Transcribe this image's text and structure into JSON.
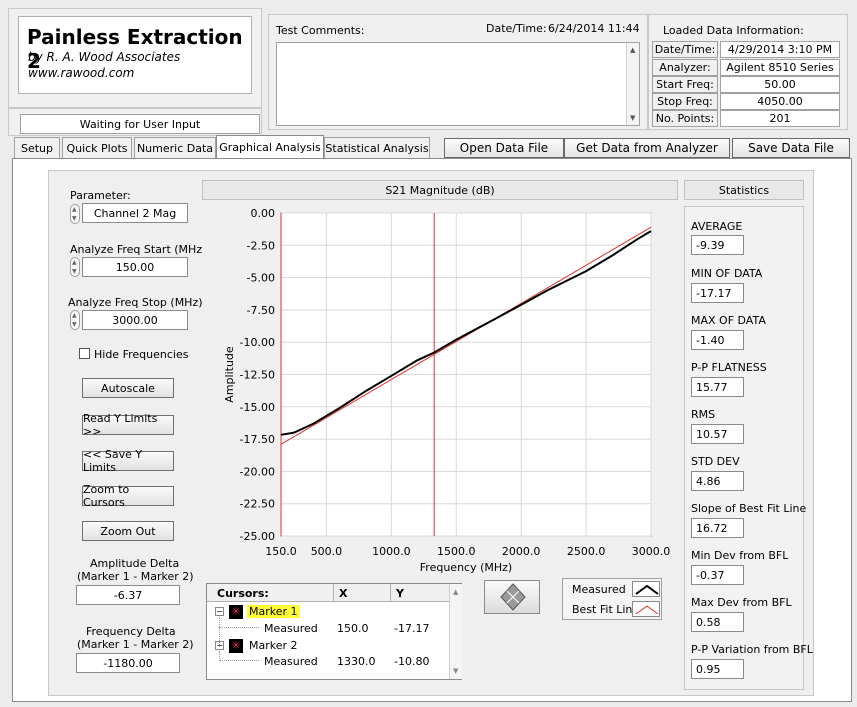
{
  "app": {
    "title": "Painless Extraction 2",
    "author": "by R. A. Wood Associates",
    "website": "www.rawood.com",
    "status": "Waiting for User Input"
  },
  "comments": {
    "label": "Test Comments:",
    "value": ""
  },
  "datetime": {
    "label": "Date/Time:",
    "value": "6/24/2014  11:44"
  },
  "loaded": {
    "title": "Loaded Data Information:",
    "rows": [
      {
        "key": "Date/Time:",
        "value": "4/29/2014 3:10 PM"
      },
      {
        "key": "Analyzer:",
        "value": "Agilent 8510 Series"
      },
      {
        "key": "Start Freq:",
        "value": "50.00"
      },
      {
        "key": "Stop Freq:",
        "value": "4050.00"
      },
      {
        "key": "No. Points:",
        "value": "201"
      }
    ]
  },
  "tabs": [
    "Setup",
    "Quick Plots",
    "Numeric Data",
    "Graphical Analysis",
    "Statistical Analysis"
  ],
  "actions": {
    "open": "Open Data File",
    "get": "Get Data from Analyzer",
    "save": "Save Data File"
  },
  "controls": {
    "parameter_label": "Parameter:",
    "parameter_value": "Channel 2 Mag",
    "start_label": "Analyze Freq Start (MHz)",
    "start_value": "150.00",
    "stop_label": "Analyze Freq Stop (MHz)",
    "stop_value": "3000.00",
    "hide_freq": "Hide Frequencies",
    "autoscale": "Autoscale",
    "read_y": "Read Y Limits >>",
    "save_y": "<< Save Y Limits",
    "zoom_cursors": "Zoom to Cursors",
    "zoom_out": "Zoom Out",
    "amp_delta_label1": "Amplitude Delta",
    "amp_delta_label2": "(Marker 1 - Marker 2)",
    "amp_delta_value": "-6.37",
    "freq_delta_label1": "Frequency Delta",
    "freq_delta_label2": "(Marker 1 - Marker 2)",
    "freq_delta_value": "-1180.00"
  },
  "cursors": {
    "headers": [
      "Cursors:",
      "X",
      "Y"
    ],
    "rows": [
      {
        "name": "Marker 1",
        "sub": "Measured",
        "x": "150.0",
        "y": "-17.17"
      },
      {
        "name": "Marker 2",
        "sub": "Measured",
        "x": "1330.0",
        "y": "-10.80"
      }
    ]
  },
  "legend": {
    "measured": "Measured",
    "bestfit": "Best Fit Line"
  },
  "statistics": {
    "title": "Statistics",
    "items": [
      {
        "label": "AVERAGE",
        "value": "-9.39"
      },
      {
        "label": "MIN OF DATA",
        "value": "-17.17"
      },
      {
        "label": "MAX OF DATA",
        "value": "-1.40"
      },
      {
        "label": "P-P FLATNESS",
        "value": "15.77"
      },
      {
        "label": "RMS",
        "value": "10.57"
      },
      {
        "label": "STD DEV",
        "value": "4.86"
      },
      {
        "label": "Slope of Best Fit Line",
        "value": "16.72"
      },
      {
        "label": "Min Dev from BFL",
        "value": "-0.37"
      },
      {
        "label": "Max Dev from BFL",
        "value": "0.58"
      },
      {
        "label": "P-P Variation from BFL",
        "value": "0.95"
      }
    ]
  },
  "colors": {
    "measured": "#000000",
    "bestfit": "#e03030",
    "cursor": "#e03040",
    "highlight": "#ffff33"
  },
  "chart_data": {
    "type": "line",
    "title": "S21 Magnitude (dB)",
    "xlabel": "Frequency (MHz)",
    "ylabel": "Amplitude",
    "xlim": [
      150,
      3000
    ],
    "ylim": [
      -25,
      0
    ],
    "xticks": [
      "150.0",
      "500.0",
      "1000.0",
      "1500.0",
      "2000.0",
      "2500.0",
      "3000.0"
    ],
    "xtick_values": [
      150,
      500,
      1000,
      1500,
      2000,
      2500,
      3000
    ],
    "yticks": [
      "0.00",
      "-2.50",
      "-5.00",
      "-7.50",
      "-10.00",
      "-12.50",
      "-15.00",
      "-17.50",
      "-20.00",
      "-22.50",
      "-25.00"
    ],
    "ytick_values": [
      0,
      -2.5,
      -5,
      -7.5,
      -10,
      -12.5,
      -15,
      -17.5,
      -20,
      -22.5,
      -25
    ],
    "grid": true,
    "series": [
      {
        "name": "Measured",
        "x": [
          150,
          250,
          400,
          600,
          800,
          1000,
          1200,
          1330,
          1500,
          1800,
          2000,
          2200,
          2500,
          2700,
          2900,
          3000
        ],
        "y": [
          -17.17,
          -17.0,
          -16.3,
          -15.1,
          -13.8,
          -12.6,
          -11.4,
          -10.8,
          -9.8,
          -8.2,
          -7.1,
          -6.0,
          -4.5,
          -3.3,
          -2.0,
          -1.4
        ]
      },
      {
        "name": "Best Fit Line",
        "x": [
          150,
          3000
        ],
        "y": [
          -17.9,
          -1.1
        ]
      }
    ],
    "cursors": [
      {
        "name": "Marker 1",
        "x": 150
      },
      {
        "name": "Marker 2",
        "x": 1330
      }
    ]
  }
}
